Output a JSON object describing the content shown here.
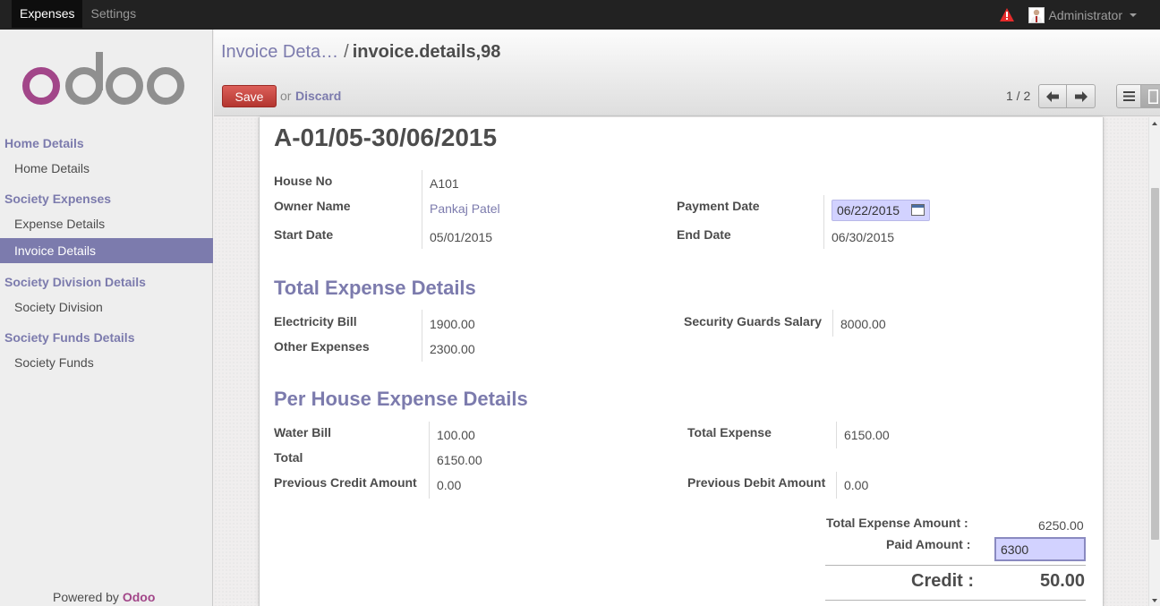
{
  "topbar": {
    "menu": [
      "Expenses",
      "Settings"
    ],
    "user": "Administrator"
  },
  "sidebar": {
    "logo_text": "odoo",
    "sections": [
      {
        "title": "Home Details",
        "items": [
          "Home Details"
        ]
      },
      {
        "title": "Society Expenses",
        "items": [
          "Expense Details",
          "Invoice Details"
        ]
      },
      {
        "title": "Society Division Details",
        "items": [
          "Society Division"
        ]
      },
      {
        "title": "Society Funds Details",
        "items": [
          "Society Funds"
        ]
      }
    ],
    "active_item": "Invoice Details",
    "powered_prefix": "Powered by",
    "powered_brand": "Odoo"
  },
  "control_panel": {
    "breadcrumb_parent": "Invoice Deta…",
    "breadcrumb_sep": "/",
    "breadcrumb_current": "invoice.details,98",
    "save_label": "Save",
    "or_label": "or",
    "discard_label": "Discard",
    "pager": "1 / 2"
  },
  "form": {
    "title": "A-01/05-30/06/2015",
    "house_no_label": "House No",
    "house_no": "A101",
    "owner_name_label": "Owner Name",
    "owner_name": "Pankaj Patel",
    "payment_date_label": "Payment Date",
    "payment_date": "06/22/2015",
    "start_date_label": "Start Date",
    "start_date": "05/01/2015",
    "end_date_label": "End Date",
    "end_date": "06/30/2015",
    "total_expense_section": "Total Expense Details",
    "electricity_label": "Electricity Bill",
    "electricity": "1900.00",
    "other_expenses_label": "Other Expenses",
    "other_expenses": "2300.00",
    "security_label": "Security Guards Salary",
    "security": "8000.00",
    "per_house_section": "Per House Expense Details",
    "water_label": "Water Bill",
    "water": "100.00",
    "total_label": "Total",
    "total": "6150.00",
    "prev_credit_label": "Previous Credit Amount",
    "prev_credit": "0.00",
    "total_expense_label": "Total Expense",
    "total_expense": "6150.00",
    "prev_debit_label": "Previous Debit Amount",
    "prev_debit": "0.00",
    "total_expense_amount_label": "Total Expense Amount :",
    "total_expense_amount": "6250.00",
    "paid_amount_label": "Paid Amount :",
    "paid_amount": "6300",
    "credit_label": "Credit :",
    "credit": "50.00"
  },
  "colors": {
    "accent": "#7c7bad",
    "brand": "#a24689",
    "save": "#c9403a",
    "input_bg": "#d2d2ff"
  }
}
